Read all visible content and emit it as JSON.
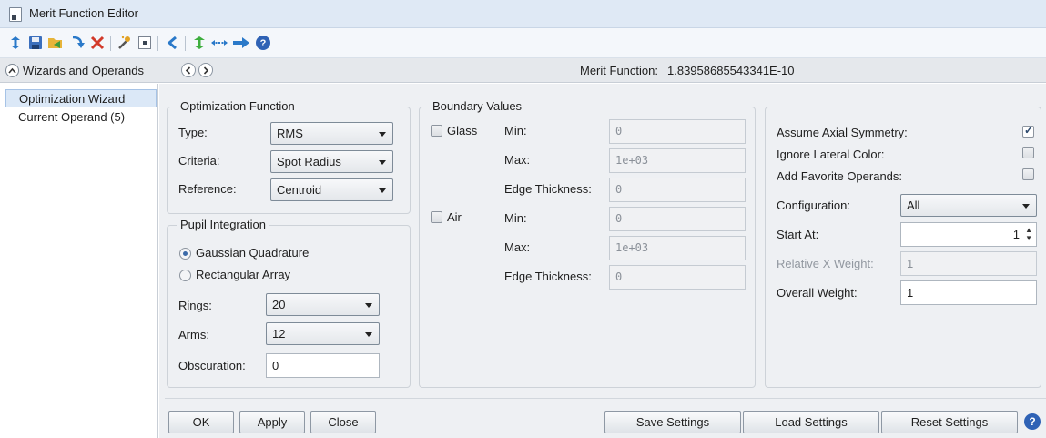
{
  "window": {
    "title": "Merit Function Editor"
  },
  "toolbar": {
    "icons": [
      "refresh-icon",
      "save-icon",
      "open-icon",
      "insert-icon",
      "delete-icon",
      "wizard-icon",
      "stop-icon",
      "undo-icon",
      "sort-icon",
      "expand-icon",
      "arrow-right-icon",
      "help-icon"
    ]
  },
  "section": {
    "title": "Wizards and Operands",
    "merit_label": "Merit Function:",
    "merit_value": "1.83958685543341E-10"
  },
  "nav": {
    "items": [
      {
        "label": "Optimization Wizard",
        "selected": true
      },
      {
        "label": "Current Operand (5)",
        "selected": false
      }
    ]
  },
  "optimization_function": {
    "legend": "Optimization Function",
    "type_label": "Type:",
    "type_value": "RMS",
    "criteria_label": "Criteria:",
    "criteria_value": "Spot Radius",
    "reference_label": "Reference:",
    "reference_value": "Centroid"
  },
  "pupil_integration": {
    "legend": "Pupil Integration",
    "gaussian_label": "Gaussian Quadrature",
    "rectangular_label": "Rectangular Array",
    "selected": "gaussian",
    "rings_label": "Rings:",
    "rings_value": "20",
    "arms_label": "Arms:",
    "arms_value": "12",
    "obscuration_label": "Obscuration:",
    "obscuration_value": "0"
  },
  "boundary_values": {
    "legend": "Boundary Values",
    "glass": {
      "label": "Glass",
      "checked": false,
      "min_label": "Min:",
      "min": "0",
      "max_label": "Max:",
      "max": "1e+03",
      "edge_label": "Edge Thickness:",
      "edge": "0"
    },
    "air": {
      "label": "Air",
      "checked": false,
      "min_label": "Min:",
      "min": "0",
      "max_label": "Max:",
      "max": "1e+03",
      "edge_label": "Edge Thickness:",
      "edge": "0"
    }
  },
  "options": {
    "assume_axial_label": "Assume Axial Symmetry:",
    "assume_axial": true,
    "ignore_lateral_label": "Ignore Lateral Color:",
    "ignore_lateral": false,
    "add_favorite_label": "Add Favorite Operands:",
    "add_favorite": false,
    "configuration_label": "Configuration:",
    "configuration_value": "All",
    "start_at_label": "Start At:",
    "start_at_value": "1",
    "relx_label": "Relative X Weight:",
    "relx_value": "1",
    "overall_label": "Overall Weight:",
    "overall_value": "1"
  },
  "buttons": {
    "ok": "OK",
    "apply": "Apply",
    "close": "Close",
    "save": "Save Settings",
    "load": "Load Settings",
    "reset": "Reset Settings"
  },
  "colors": {
    "accent": "#2f62b5",
    "titlebar": "#dfe9f5",
    "panel": "#eef0f3"
  }
}
